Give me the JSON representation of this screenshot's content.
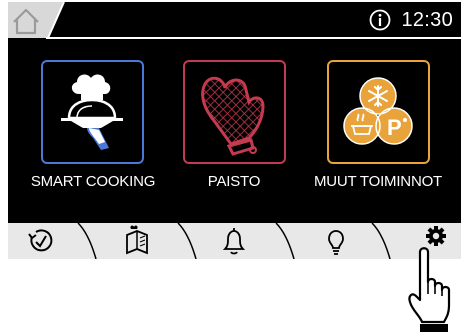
{
  "header": {
    "home_icon": "home-icon",
    "info_icon": "info-icon",
    "time": "12:30"
  },
  "tiles": [
    {
      "label": "SMART COOKING",
      "icon": "chef-serving-tray-icon",
      "color": "#4a78d8"
    },
    {
      "label": "PAISTO",
      "icon": "oven-mitt-icon",
      "color": "#c43a4e"
    },
    {
      "label": "MUUT TOIMINNOT",
      "icon": "other-functions-icon",
      "color": "#e8a33a"
    }
  ],
  "bottom_nav": [
    {
      "icon": "timer-icon"
    },
    {
      "icon": "recipe-book-icon"
    },
    {
      "icon": "bell-icon"
    },
    {
      "icon": "lightbulb-icon"
    },
    {
      "icon": "gear-icon"
    }
  ],
  "colors": {
    "screen_bg": "#000000",
    "bar_bg": "#e8e8e8"
  }
}
